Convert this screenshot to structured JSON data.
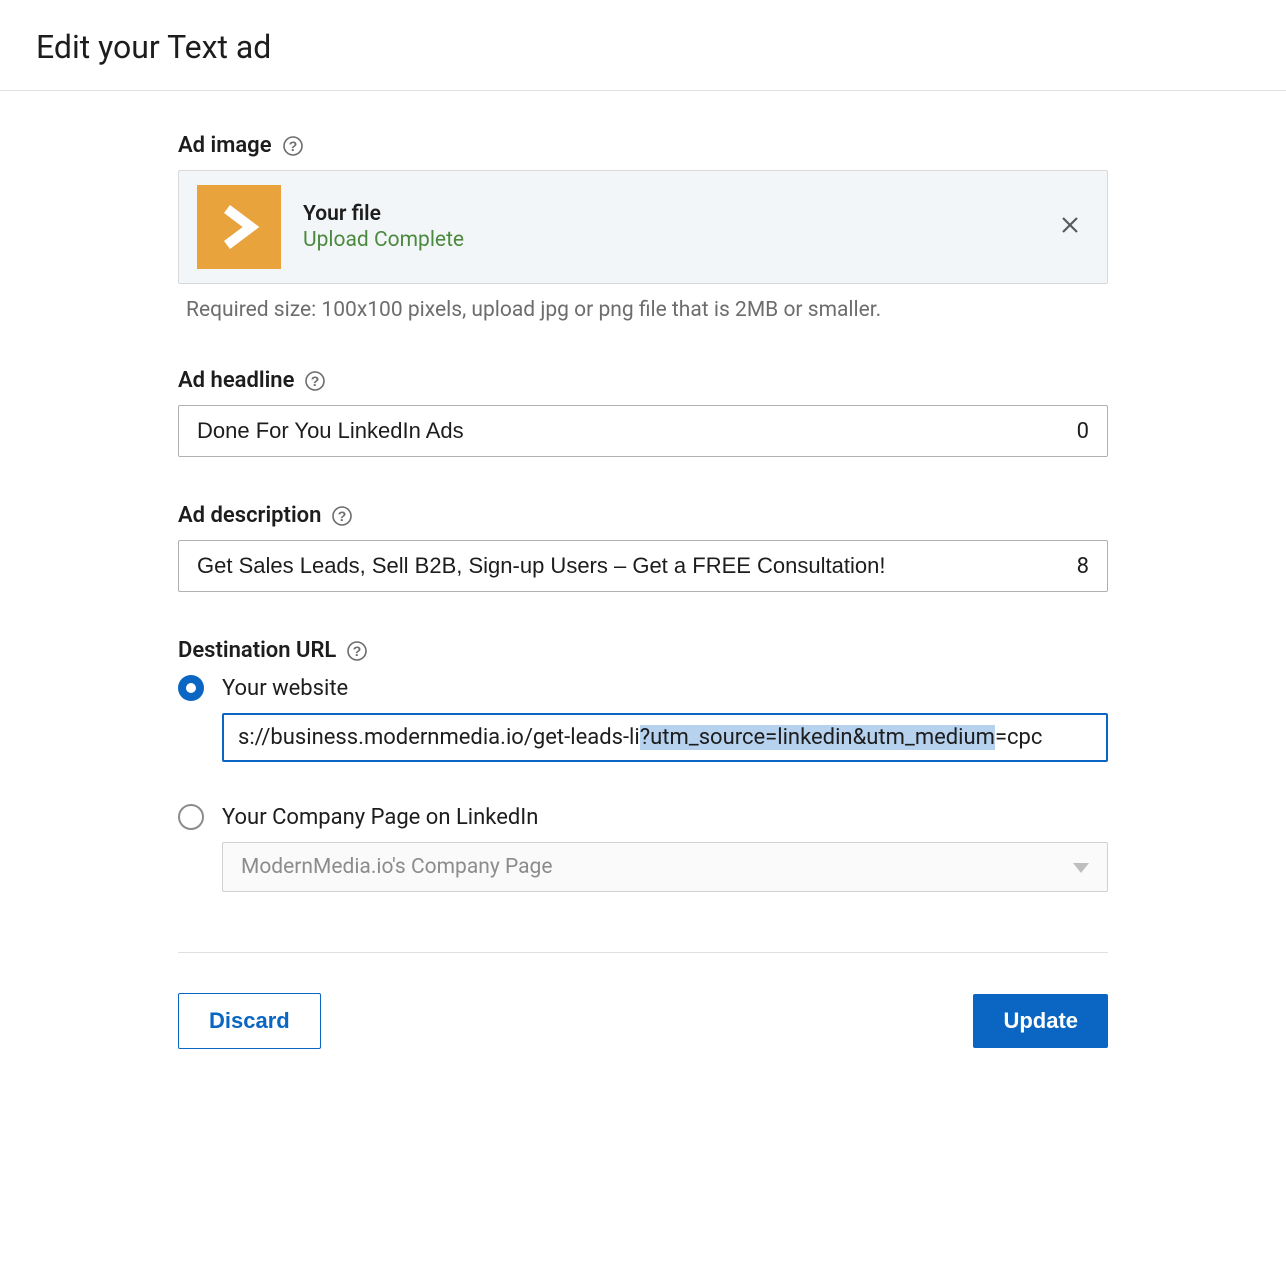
{
  "page": {
    "title": "Edit your Text ad"
  },
  "image": {
    "label": "Ad image",
    "file_label": "Your file",
    "status": "Upload Complete",
    "hint": "Required size: 100x100 pixels, upload jpg or png file that is 2MB or smaller."
  },
  "headline": {
    "label": "Ad headline",
    "value": "Done For You LinkedIn Ads",
    "counter": "0"
  },
  "description": {
    "label": "Ad description",
    "value": "Get Sales Leads, Sell B2B, Sign-up Users – Get a FREE Consultation!",
    "counter": "8"
  },
  "destination": {
    "label": "Destination URL",
    "website": {
      "label": "Your website",
      "url_prefix": "s://business.modernmedia.io/get-leads-li",
      "url_highlight": "?utm_source=linkedin&utm_medium",
      "url_suffix": "=cpc"
    },
    "company": {
      "label": "Your Company Page on LinkedIn",
      "placeholder": "ModernMedia.io's Company Page"
    }
  },
  "footer": {
    "discard": "Discard",
    "update": "Update"
  }
}
